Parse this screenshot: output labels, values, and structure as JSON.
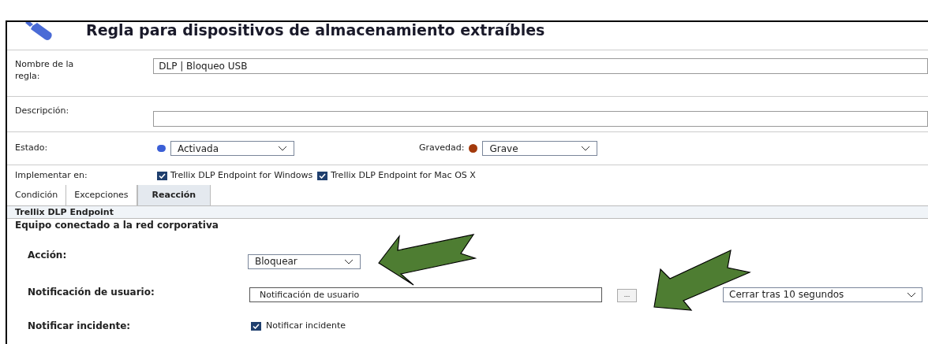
{
  "title": "Regla para dispositivos de almacenamiento extraíbles",
  "rule_name": {
    "label": "Nombre de la regla:",
    "value": "DLP | Bloqueo USB"
  },
  "description": {
    "label": "Descripción:"
  },
  "status": {
    "label": "Estado:",
    "value": "Activada",
    "color": "#3b5fd6"
  },
  "severity": {
    "label": "Gravedad:",
    "value": "Grave",
    "color": "#a33a0c"
  },
  "implement": {
    "label": "Implementar en:",
    "options": [
      {
        "label": "Trellix DLP Endpoint for Windows",
        "checked": true
      },
      {
        "label": "Trellix DLP Endpoint for Mac OS X",
        "checked": true
      }
    ]
  },
  "tabs": [
    {
      "label": "Condición",
      "selected": false
    },
    {
      "label": "Excepciones",
      "selected": false
    },
    {
      "label": "Reacción",
      "selected": true
    }
  ],
  "section_header": "Trellix DLP Endpoint",
  "subsection_title": "Equipo conectado a la red corporativa",
  "action": {
    "label": "Acción:",
    "value": "Bloquear"
  },
  "notification": {
    "label": "Notificación de usuario:",
    "value": "Notificación de usuario",
    "button": "...",
    "duration": "Cerrar tras 10 segundos"
  },
  "incident": {
    "label": "Notificar incidente:",
    "checkbox_label": "Notificar incidente",
    "checked": true
  }
}
